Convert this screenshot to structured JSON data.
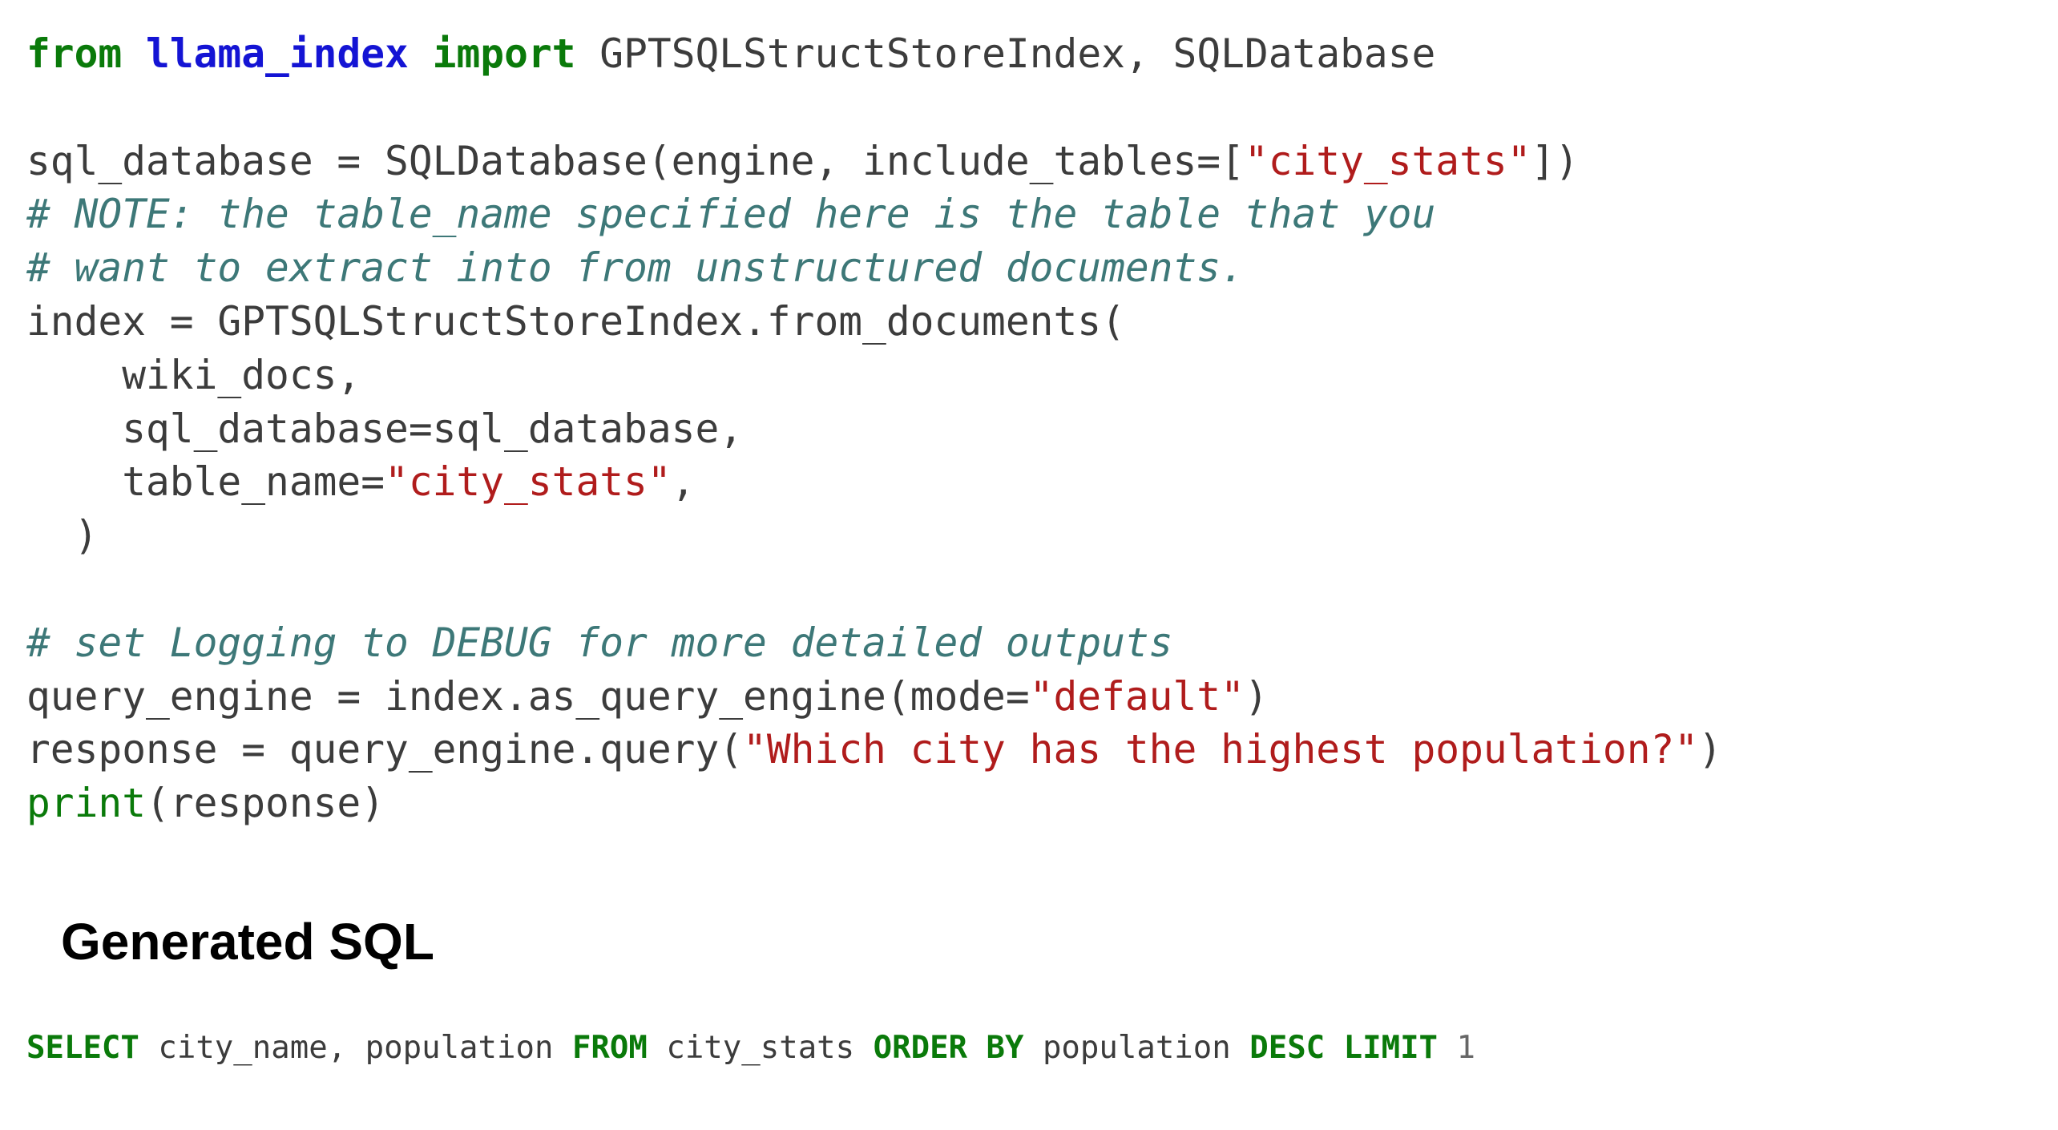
{
  "code_lines": [
    [
      {
        "t": "from",
        "k": "kw"
      },
      {
        "t": " ",
        "k": "plain"
      },
      {
        "t": "llama_index",
        "k": "mod"
      },
      {
        "t": " ",
        "k": "plain"
      },
      {
        "t": "import",
        "k": "kw"
      },
      {
        "t": " GPTSQLStructStoreIndex, SQLDatabase",
        "k": "plain"
      }
    ],
    [],
    [
      {
        "t": "sql_database = SQLDatabase(engine, include_tables=[",
        "k": "plain"
      },
      {
        "t": "\"city_stats\"",
        "k": "str"
      },
      {
        "t": "])",
        "k": "plain"
      }
    ],
    [
      {
        "t": "# NOTE: the table_name specified here is the table that you",
        "k": "comment"
      }
    ],
    [
      {
        "t": "# want to extract into from unstructured documents.",
        "k": "comment"
      }
    ],
    [
      {
        "t": "index = GPTSQLStructStoreIndex.from_documents(",
        "k": "plain"
      }
    ],
    [
      {
        "t": "    wiki_docs,",
        "k": "plain"
      }
    ],
    [
      {
        "t": "    sql_database=sql_database,",
        "k": "plain"
      }
    ],
    [
      {
        "t": "    table_name=",
        "k": "plain"
      },
      {
        "t": "\"city_stats\"",
        "k": "str"
      },
      {
        "t": ",",
        "k": "plain"
      }
    ],
    [
      {
        "t": "  )",
        "k": "plain"
      }
    ],
    [],
    [
      {
        "t": "# set Logging to DEBUG for more detailed outputs",
        "k": "comment"
      }
    ],
    [
      {
        "t": "query_engine = index.as_query_engine(mode=",
        "k": "plain"
      },
      {
        "t": "\"default\"",
        "k": "str"
      },
      {
        "t": ")",
        "k": "plain"
      }
    ],
    [
      {
        "t": "response = query_engine.query(",
        "k": "plain"
      },
      {
        "t": "\"Which city has the highest population?\"",
        "k": "str"
      },
      {
        "t": ")",
        "k": "plain"
      }
    ],
    [
      {
        "t": "print",
        "k": "builtin"
      },
      {
        "t": "(response)",
        "k": "plain"
      }
    ]
  ],
  "heading": "Generated SQL",
  "sql_tokens": [
    {
      "t": "SELECT",
      "k": "kw"
    },
    {
      "t": " city_name, population ",
      "k": "plain"
    },
    {
      "t": "FROM",
      "k": "kw"
    },
    {
      "t": " city_stats ",
      "k": "plain"
    },
    {
      "t": "ORDER BY",
      "k": "kw"
    },
    {
      "t": " population ",
      "k": "plain"
    },
    {
      "t": "DESC",
      "k": "kw"
    },
    {
      "t": " ",
      "k": "plain"
    },
    {
      "t": "LIMIT",
      "k": "kw"
    },
    {
      "t": " ",
      "k": "plain"
    },
    {
      "t": "1",
      "k": "num"
    }
  ]
}
